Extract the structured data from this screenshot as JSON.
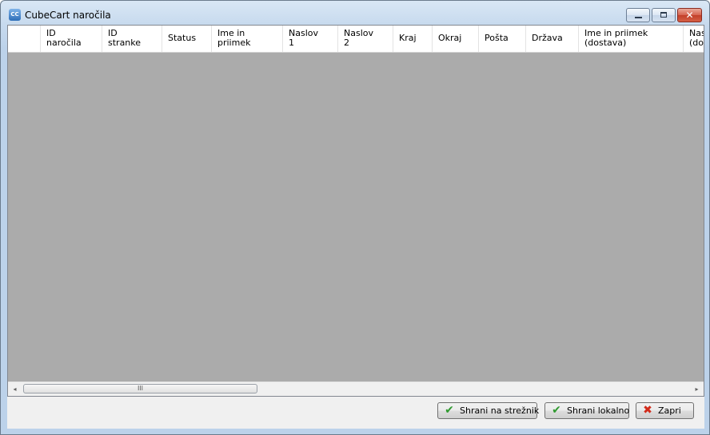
{
  "window": {
    "title": "CubeCart naročila",
    "app_icon_text": "CC",
    "controls": {
      "minimize": "",
      "maximize": "",
      "close": "✕"
    }
  },
  "grid": {
    "columns": [
      "ID\nnaročila",
      "ID\nstranke",
      "Status",
      "Ime in\npriimek",
      "Naslov\n1",
      "Naslov\n2",
      "Kraj",
      "Okraj",
      "Pošta",
      "Država",
      "Ime in priimek\n(dostava)",
      "Nas\n(dos"
    ],
    "rows": []
  },
  "scrollbar": {
    "left_arrow": "◂",
    "right_arrow": "▸",
    "thumb_grip": "III"
  },
  "buttons": {
    "save_server": "Shrani na strežnik",
    "save_local": "Shrani lokalno",
    "close": "Zapri"
  },
  "icons": {
    "save_server": "checkmark-icon",
    "save_local": "checkmark-icon",
    "close": "red-x-icon"
  }
}
